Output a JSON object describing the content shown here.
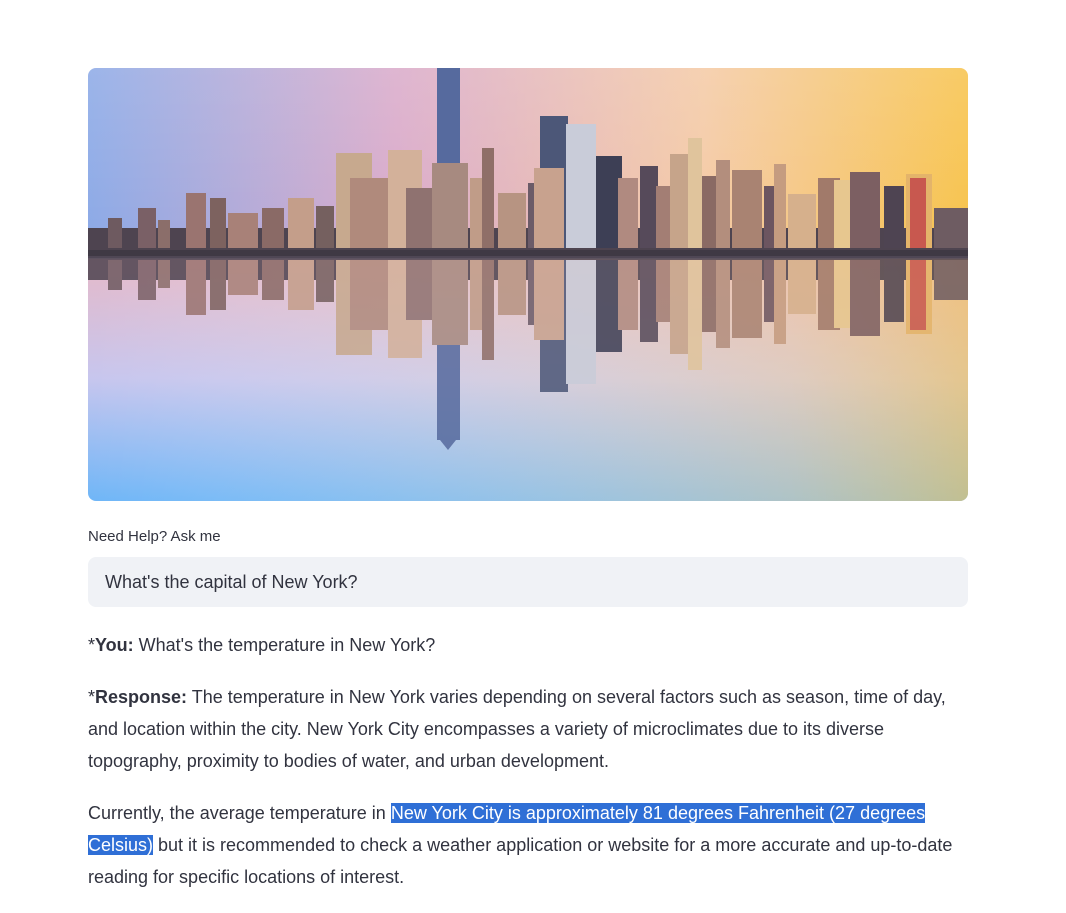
{
  "hero_image": {
    "alt": "New York City skyline reflected in water at sunset"
  },
  "input": {
    "label": "Need Help? Ask me",
    "value": "What's the capital of New York?"
  },
  "chat": {
    "user_prefix": "*",
    "user_label": "You:",
    "user_text": " What's the temperature in New York?",
    "response_prefix": "*",
    "response_label": "Response:",
    "response_text": " The temperature in New York varies depending on several factors such as season, time of day, and location within the city. New York City encompasses a variety of microclimates due to its diverse topography, proximity to bodies of water, and urban development.",
    "para2_before": "Currently, the average temperature in ",
    "para2_highlight": "New York City is approximately 81 degrees Fahrenheit (27 degrees Celsius)",
    "para2_after": " but it is recommended to check a weather application or website for a more accurate and up-to-date reading for specific locations of interest."
  },
  "colors": {
    "highlight": "#2f6fd6",
    "input_bg": "#f0f2f6",
    "text": "#31333f"
  }
}
